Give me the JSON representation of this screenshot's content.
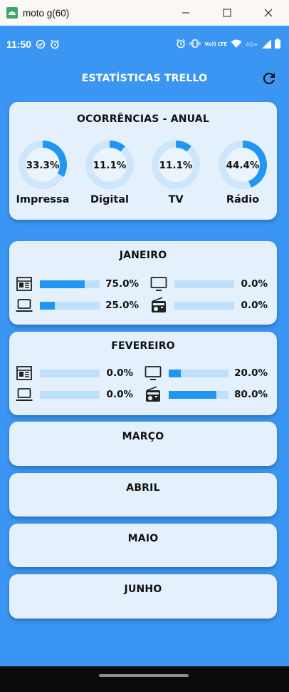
{
  "window": {
    "title": "moto g(60)",
    "controls": {
      "minimize": "—",
      "maximize": "☐",
      "close": "✕"
    }
  },
  "statusbar": {
    "time": "11:50",
    "network": "Vo)) LTE",
    "network_4g": "4G+"
  },
  "appbar": {
    "title": "ESTATÍSTICAS TRELLO",
    "refresh_icon": "refresh-icon"
  },
  "annual": {
    "title": "OCORRÊNCIAS - ANUAL",
    "items": [
      {
        "label": "Impressa",
        "value_text": "33.3%",
        "fraction": 0.333
      },
      {
        "label": "Digital",
        "value_text": "11.1%",
        "fraction": 0.111
      },
      {
        "label": "TV",
        "value_text": "11.1%",
        "fraction": 0.111
      },
      {
        "label": "Rádio",
        "value_text": "44.4%",
        "fraction": 0.444
      }
    ]
  },
  "months": [
    {
      "name": "JANEIRO",
      "rows": [
        {
          "impressa": {
            "text": "75.0%",
            "fraction": 0.75
          },
          "tv": {
            "text": "0.0%",
            "fraction": 0.0
          }
        },
        {
          "digital": {
            "text": "25.0%",
            "fraction": 0.25
          },
          "radio": {
            "text": "0.0%",
            "fraction": 0.0
          }
        }
      ]
    },
    {
      "name": "FEVEREIRO",
      "rows": [
        {
          "impressa": {
            "text": "0.0%",
            "fraction": 0.0
          },
          "tv": {
            "text": "20.0%",
            "fraction": 0.2
          }
        },
        {
          "digital": {
            "text": "0.0%",
            "fraction": 0.0
          },
          "radio": {
            "text": "80.0%",
            "fraction": 0.8
          }
        }
      ]
    },
    {
      "name": "MARÇO"
    },
    {
      "name": "ABRIL"
    },
    {
      "name": "MAIO"
    },
    {
      "name": "JUNHO"
    }
  ],
  "colors": {
    "background": "#3b95f3",
    "card": "#e4f1fd",
    "accent": "#2196f3",
    "track": "#bfe0fb"
  }
}
